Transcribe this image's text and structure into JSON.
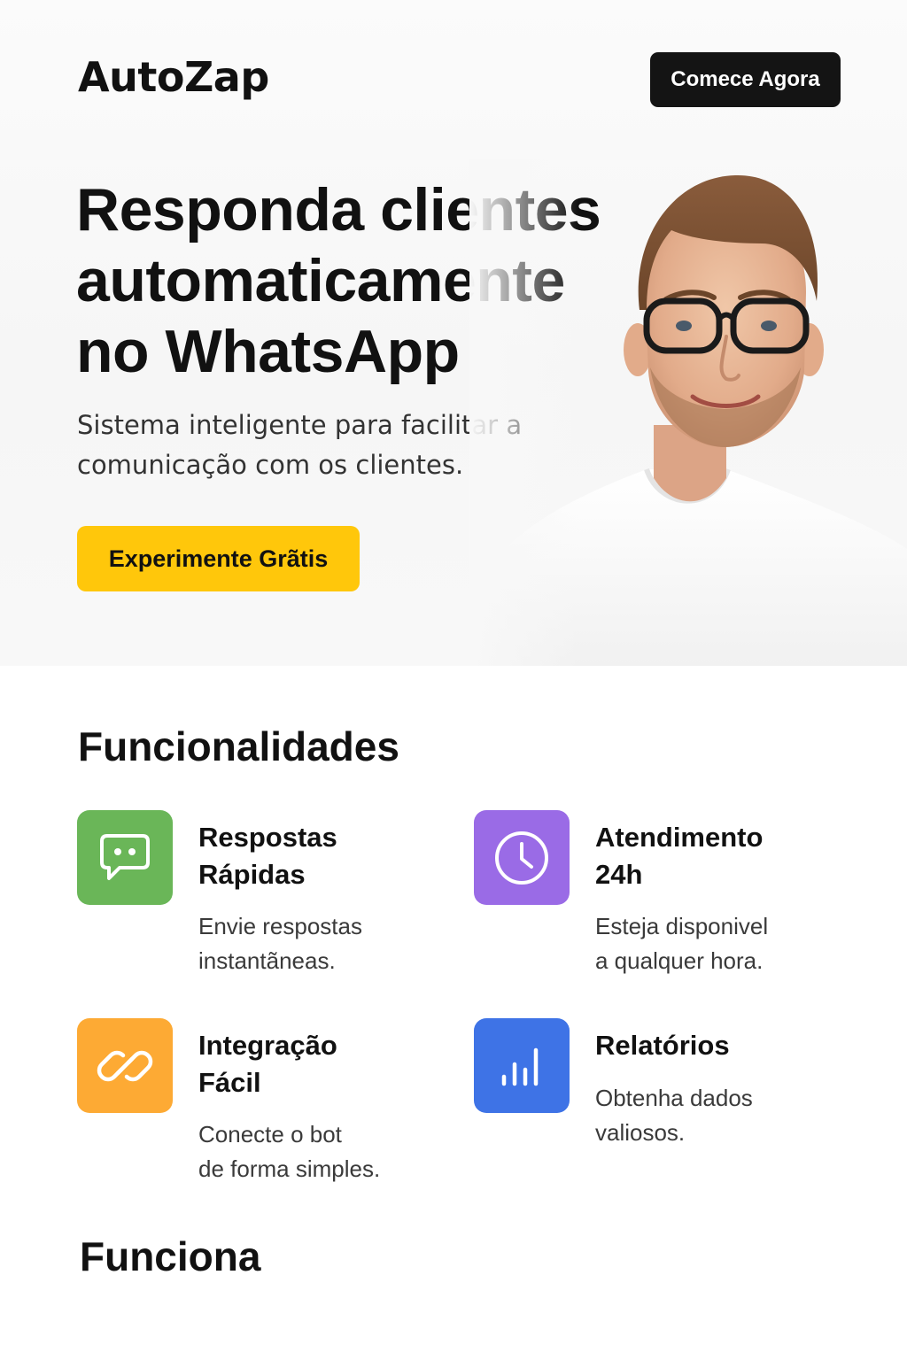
{
  "header": {
    "logo": "AutoZap",
    "cta_label": "Comece Agora"
  },
  "hero": {
    "title_lines": [
      "Responda clientes",
      "automaticamente",
      "no WhatsApp"
    ],
    "subtitle_lines": [
      "Sistema inteligente para facilitar a",
      "comunicação com os clientes."
    ],
    "cta_label": "Experimente Grãtis"
  },
  "features": {
    "heading": "Funcionalidades",
    "items": [
      {
        "title_lines": [
          "Respostas",
          "Rápidas"
        ],
        "desc_lines": [
          "Envie respostas",
          "instantãneas."
        ],
        "icon": "chat-bubble-icon",
        "color": "#6ab658"
      },
      {
        "title_lines": [
          "Atendimento",
          "24h"
        ],
        "desc_lines": [
          "Esteja disponivel",
          "a qualquer hora."
        ],
        "icon": "clock-icon",
        "color": "#9a6be6"
      },
      {
        "title_lines": [
          "Integração",
          "Fácil"
        ],
        "desc_lines": [
          "Conecte o bot",
          "de forma simples."
        ],
        "icon": "link-icon",
        "color": "#fdaa34"
      },
      {
        "title_lines": [
          "Relatórios"
        ],
        "desc_lines": [
          "Obtenha dados",
          "valiosos."
        ],
        "icon": "bar-chart-icon",
        "color": "#3e73e6"
      }
    ]
  },
  "how": {
    "heading": "Funciona"
  },
  "colors": {
    "cta_dark": "#141414",
    "cta_yellow": "#ffc70b"
  }
}
